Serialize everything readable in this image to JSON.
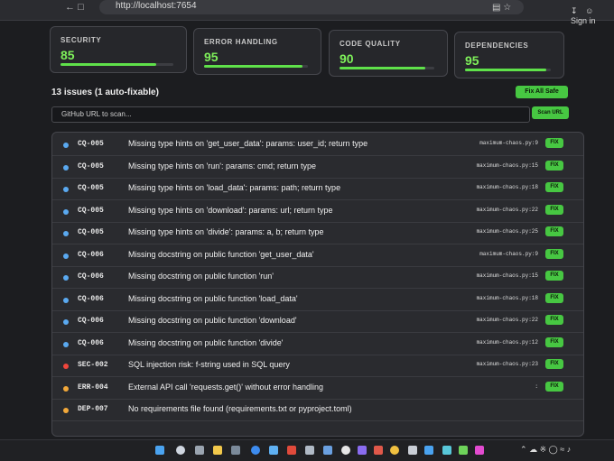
{
  "browser": {
    "url": "http://localhost:7654",
    "account_label": "Sign in"
  },
  "metrics": [
    {
      "label": "SECURITY",
      "value": "85",
      "level": 0.85
    },
    {
      "label": "ERROR HANDLING",
      "value": "95",
      "level": 0.95
    },
    {
      "label": "CODE QUALITY",
      "value": "90",
      "level": 0.9
    },
    {
      "label": "DEPENDENCIES",
      "value": "95",
      "level": 0.95
    }
  ],
  "summary": "13 issues (1 auto-fixable)",
  "fix_all_label": "Fix All Safe",
  "search": {
    "placeholder": "GitHub URL to scan..."
  },
  "scan_label": "Scan URL",
  "fix_label": "FIX",
  "colors": {
    "info": "#5aa9f0",
    "error": "#f0463c",
    "warning": "#f2a83a",
    "accent": "#47c742"
  },
  "issues": [
    {
      "severity": "info",
      "code": "CQ-005",
      "message": "Missing type hints on 'get_user_data': params: user_id; return type",
      "file": "maximum-chaos.py:9"
    },
    {
      "severity": "info",
      "code": "CQ-005",
      "message": "Missing type hints on 'run': params: cmd; return type",
      "file": "maximum-chaos.py:15"
    },
    {
      "severity": "info",
      "code": "CQ-005",
      "message": "Missing type hints on 'load_data': params: path; return type",
      "file": "maximum-chaos.py:18"
    },
    {
      "severity": "info",
      "code": "CQ-005",
      "message": "Missing type hints on 'download': params: url; return type",
      "file": "maximum-chaos.py:22"
    },
    {
      "severity": "info",
      "code": "CQ-005",
      "message": "Missing type hints on 'divide': params: a, b; return type",
      "file": "maximum-chaos.py:25"
    },
    {
      "severity": "info",
      "code": "CQ-006",
      "message": "Missing docstring on public function 'get_user_data'",
      "file": "maximum-chaos.py:9"
    },
    {
      "severity": "info",
      "code": "CQ-006",
      "message": "Missing docstring on public function 'run'",
      "file": "maximum-chaos.py:15"
    },
    {
      "severity": "info",
      "code": "CQ-006",
      "message": "Missing docstring on public function 'load_data'",
      "file": "maximum-chaos.py:18"
    },
    {
      "severity": "info",
      "code": "CQ-006",
      "message": "Missing docstring on public function 'download'",
      "file": "maximum-chaos.py:22"
    },
    {
      "severity": "info",
      "code": "CQ-006",
      "message": "Missing docstring on public function 'divide'",
      "file": "maximum-chaos.py:12"
    },
    {
      "severity": "error",
      "code": "SEC-002",
      "message": "SQL injection risk: f-string used in SQL query",
      "file": "maximum-chaos.py:23"
    },
    {
      "severity": "warning",
      "code": "ERR-004",
      "message": "External API call 'requests.get()' without error handling",
      "file": ":"
    },
    {
      "severity": "warning",
      "code": "DEP-007",
      "message": "No requirements file found (requirements.txt or pyproject.toml)",
      "file": ""
    }
  ]
}
